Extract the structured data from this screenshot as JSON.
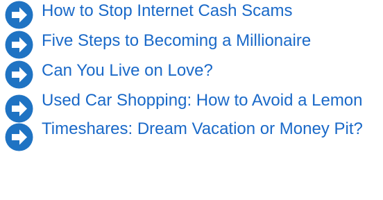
{
  "links": [
    {
      "label": "How to Stop Internet Cash Scams",
      "icon": "arrow-circle-icon"
    },
    {
      "label": "Five Steps to Becoming a Millionaire",
      "icon": "arrow-circle-icon"
    },
    {
      "label": "Can You Live on Love?",
      "icon": "arrow-circle-icon"
    },
    {
      "label": "Used Car Shopping: How to Avoid a Lemon",
      "icon": "arrow-circle-icon"
    },
    {
      "label": "Timeshares: Dream Vacation or Money Pit?",
      "icon": "arrow-circle-icon"
    }
  ],
  "colors": {
    "link": "#1a69c8",
    "icon_fill": "#1f73c3",
    "icon_arrow": "#ffffff"
  }
}
